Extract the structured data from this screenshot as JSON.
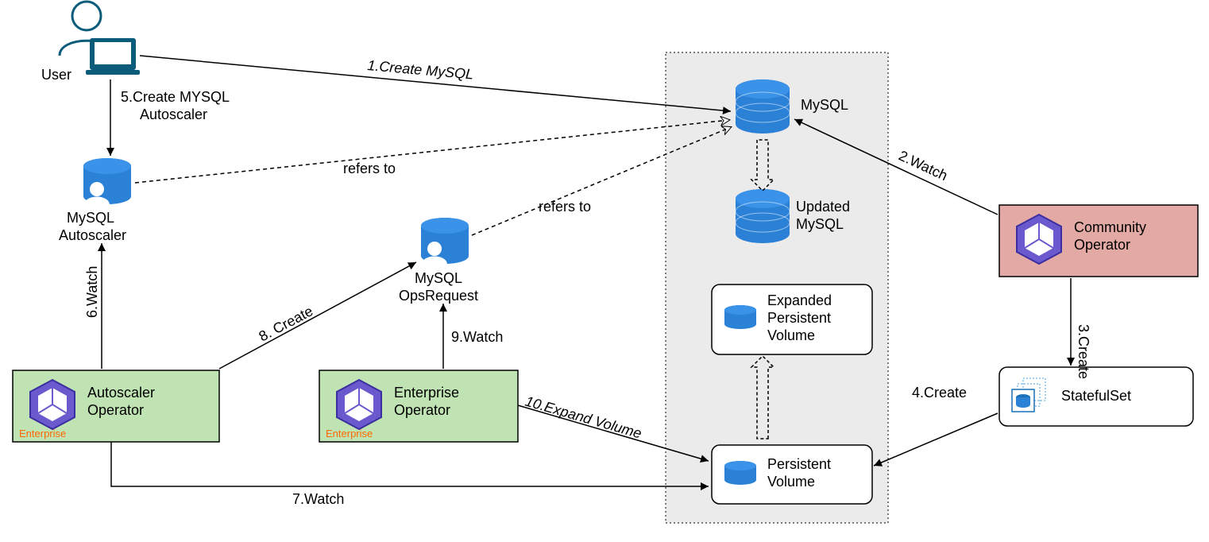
{
  "nodes": {
    "user": "User",
    "mysql_autoscaler_l1": "MySQL",
    "mysql_autoscaler_l2": "Autoscaler",
    "mysql_opsrequest_l1": "MySQL",
    "mysql_opsrequest_l2": "OpsRequest",
    "autoscaler_op_l1": "Autoscaler",
    "autoscaler_op_l2": "Operator",
    "enterprise_op_l1": "Enterprise",
    "enterprise_op_l2": "Operator",
    "enterprise_tag": "Enterprise",
    "community_op_l1": "Community",
    "community_op_l2": "Operator",
    "statefulset": "StatefulSet",
    "mysql": "MySQL",
    "updated_mysql_l1": "Updated",
    "updated_mysql_l2": "MySQL",
    "expanded_pv_l1": "Expanded",
    "expanded_pv_l2": "Persistent",
    "expanded_pv_l3": "Volume",
    "pv_l1": "Persistent",
    "pv_l2": "Volume"
  },
  "edges": {
    "e1": "1.Create MySQL",
    "e2": "2.Watch",
    "e3": "3.Create",
    "e4": "4.Create",
    "e5a": "5.Create MYSQL",
    "e5b": "Autoscaler",
    "e6": "6.Watch",
    "e7": "7.Watch",
    "e8": "8. Create",
    "e9": "9.Watch",
    "e10": "10.Expand Volume",
    "refers": "refers to"
  }
}
